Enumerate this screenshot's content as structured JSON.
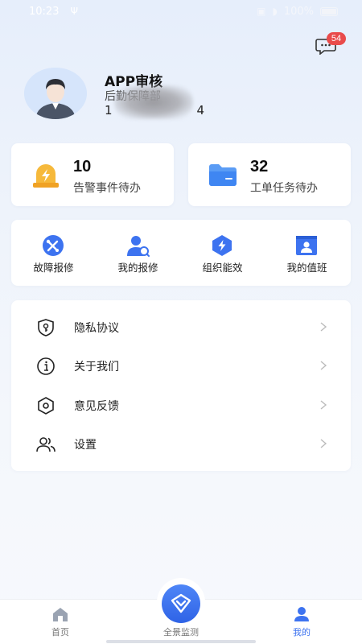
{
  "status_bar": {
    "time": "10:23",
    "battery": "100%"
  },
  "messages": {
    "badge_count": "54"
  },
  "profile": {
    "name": "APP审核",
    "department": "后勤保障部",
    "phone_start": "1",
    "phone_end": "4"
  },
  "todos": [
    {
      "count": "10",
      "label": "告警事件待办",
      "icon": "alarm-icon"
    },
    {
      "count": "32",
      "label": "工单任务待办",
      "icon": "folder-icon"
    }
  ],
  "quick_actions": [
    {
      "label": "故障报修",
      "icon": "tools-icon"
    },
    {
      "label": "我的报修",
      "icon": "user-search-icon"
    },
    {
      "label": "组织能效",
      "icon": "energy-icon"
    },
    {
      "label": "我的值班",
      "icon": "duty-badge-icon"
    }
  ],
  "menu": [
    {
      "label": "隐私协议",
      "icon": "shield-key-icon"
    },
    {
      "label": "关于我们",
      "icon": "info-icon"
    },
    {
      "label": "意见反馈",
      "icon": "feedback-hexagon-icon"
    },
    {
      "label": "设置",
      "icon": "users-icon"
    }
  ],
  "tabbar": {
    "home": "首页",
    "monitor": "全景监测",
    "mine": "我的"
  },
  "colors": {
    "accent": "#3d73f0",
    "badge": "#e94b4b",
    "warning": "#f5b63a"
  }
}
